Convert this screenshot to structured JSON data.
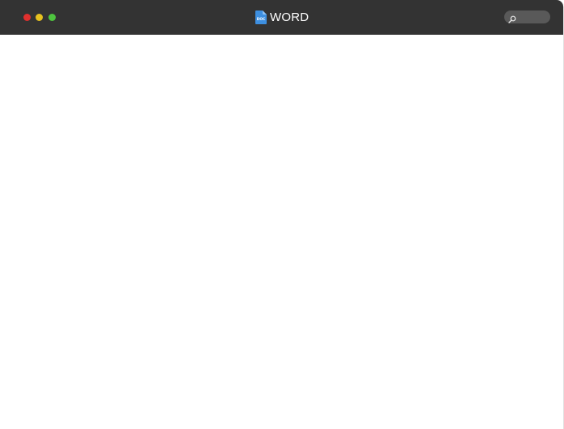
{
  "window": {
    "title": "WORD",
    "icon": "doc-file-icon",
    "icon_label": "DOC",
    "controls": [
      "close",
      "minimize",
      "zoom"
    ]
  },
  "search": {
    "icon": "search-icon",
    "placeholder": ""
  },
  "colors": {
    "titlebar": "#333333",
    "close": "#e0302e",
    "minimize": "#e6c11f",
    "zoom": "#4ec43f",
    "doc_icon": "#3d8fe0",
    "search_field": "#595959"
  }
}
